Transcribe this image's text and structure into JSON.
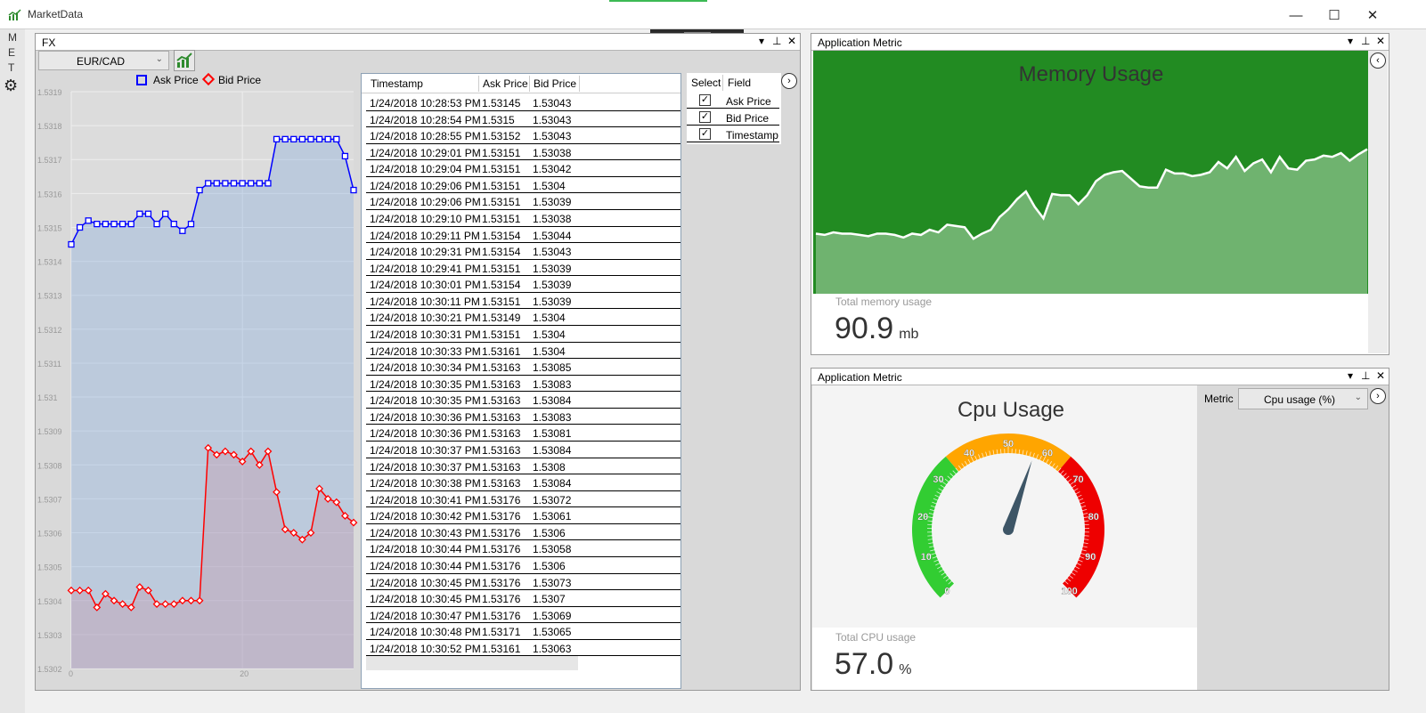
{
  "app": {
    "title": "MarketData",
    "accent": "#3cba54"
  },
  "window_controls": {
    "minimize": "—",
    "maximize": "☐",
    "close": "✕"
  },
  "sidebar": {
    "letters": [
      "M",
      "E",
      "T"
    ],
    "settings_icon": "gear-icon"
  },
  "fx": {
    "title": "FX",
    "panel_controls": [
      "▾",
      "⊥",
      "✕"
    ],
    "currency": "EUR/CAD",
    "legend": [
      {
        "label": "Ask Price",
        "color": "#0000ff"
      },
      {
        "label": "Bid Price",
        "color": "#ff0000"
      }
    ],
    "table": {
      "headers": [
        "Timestamp",
        "Ask Price",
        "Bid Price"
      ],
      "rows": [
        [
          "1/24/2018 10:28:53 PM",
          "1.53145",
          "1.53043"
        ],
        [
          "1/24/2018 10:28:54 PM",
          "1.5315",
          "1.53043"
        ],
        [
          "1/24/2018 10:28:55 PM",
          "1.53152",
          "1.53043"
        ],
        [
          "1/24/2018 10:29:01 PM",
          "1.53151",
          "1.53038"
        ],
        [
          "1/24/2018 10:29:04 PM",
          "1.53151",
          "1.53042"
        ],
        [
          "1/24/2018 10:29:06 PM",
          "1.53151",
          "1.5304"
        ],
        [
          "1/24/2018 10:29:06 PM",
          "1.53151",
          "1.53039"
        ],
        [
          "1/24/2018 10:29:10 PM",
          "1.53151",
          "1.53038"
        ],
        [
          "1/24/2018 10:29:11 PM",
          "1.53154",
          "1.53044"
        ],
        [
          "1/24/2018 10:29:31 PM",
          "1.53154",
          "1.53043"
        ],
        [
          "1/24/2018 10:29:41 PM",
          "1.53151",
          "1.53039"
        ],
        [
          "1/24/2018 10:30:01 PM",
          "1.53154",
          "1.53039"
        ],
        [
          "1/24/2018 10:30:11 PM",
          "1.53151",
          "1.53039"
        ],
        [
          "1/24/2018 10:30:21 PM",
          "1.53149",
          "1.5304"
        ],
        [
          "1/24/2018 10:30:31 PM",
          "1.53151",
          "1.5304"
        ],
        [
          "1/24/2018 10:30:33 PM",
          "1.53161",
          "1.5304"
        ],
        [
          "1/24/2018 10:30:34 PM",
          "1.53163",
          "1.53085"
        ],
        [
          "1/24/2018 10:30:35 PM",
          "1.53163",
          "1.53083"
        ],
        [
          "1/24/2018 10:30:35 PM",
          "1.53163",
          "1.53084"
        ],
        [
          "1/24/2018 10:30:36 PM",
          "1.53163",
          "1.53083"
        ],
        [
          "1/24/2018 10:30:36 PM",
          "1.53163",
          "1.53081"
        ],
        [
          "1/24/2018 10:30:37 PM",
          "1.53163",
          "1.53084"
        ],
        [
          "1/24/2018 10:30:37 PM",
          "1.53163",
          "1.5308"
        ],
        [
          "1/24/2018 10:30:38 PM",
          "1.53163",
          "1.53084"
        ],
        [
          "1/24/2018 10:30:41 PM",
          "1.53176",
          "1.53072"
        ],
        [
          "1/24/2018 10:30:42 PM",
          "1.53176",
          "1.53061"
        ],
        [
          "1/24/2018 10:30:43 PM",
          "1.53176",
          "1.5306"
        ],
        [
          "1/24/2018 10:30:44 PM",
          "1.53176",
          "1.53058"
        ],
        [
          "1/24/2018 10:30:44 PM",
          "1.53176",
          "1.5306"
        ],
        [
          "1/24/2018 10:30:45 PM",
          "1.53176",
          "1.53073"
        ],
        [
          "1/24/2018 10:30:45 PM",
          "1.53176",
          "1.5307"
        ],
        [
          "1/24/2018 10:30:47 PM",
          "1.53176",
          "1.53069"
        ],
        [
          "1/24/2018 10:30:48 PM",
          "1.53171",
          "1.53065"
        ],
        [
          "1/24/2018 10:30:52 PM",
          "1.53161",
          "1.53063"
        ]
      ]
    },
    "field_selector": {
      "headers": [
        "Select",
        "Field"
      ],
      "fields": [
        {
          "label": "Ask Price",
          "checked": true
        },
        {
          "label": "Bid Price",
          "checked": true
        },
        {
          "label": "Timestamp",
          "checked": true
        }
      ]
    }
  },
  "chart_data": {
    "type": "line",
    "title": "",
    "xlabel": "",
    "ylabel": "",
    "ylim": [
      1.5302,
      1.5319
    ],
    "yticks": [
      "1.5319",
      "1.5318",
      "1.5317",
      "1.5316",
      "1.5315",
      "1.5314",
      "1.5313",
      "1.5312",
      "1.5311",
      "1.531",
      "1.5309",
      "1.5308",
      "1.5307",
      "1.5306",
      "1.5305",
      "1.5304",
      "1.5303",
      "1.5302"
    ],
    "xticks": [
      "0",
      "20"
    ],
    "xlim": [
      0,
      33
    ],
    "grid": true,
    "legend_position": "top",
    "series": [
      {
        "name": "Ask Price",
        "color": "#0000ff",
        "values": [
          1.53145,
          1.5315,
          1.53152,
          1.53151,
          1.53151,
          1.53151,
          1.53151,
          1.53151,
          1.53154,
          1.53154,
          1.53151,
          1.53154,
          1.53151,
          1.53149,
          1.53151,
          1.53161,
          1.53163,
          1.53163,
          1.53163,
          1.53163,
          1.53163,
          1.53163,
          1.53163,
          1.53163,
          1.53176,
          1.53176,
          1.53176,
          1.53176,
          1.53176,
          1.53176,
          1.53176,
          1.53176,
          1.53171,
          1.53161
        ]
      },
      {
        "name": "Bid Price",
        "color": "#ff0000",
        "values": [
          1.53043,
          1.53043,
          1.53043,
          1.53038,
          1.53042,
          1.5304,
          1.53039,
          1.53038,
          1.53044,
          1.53043,
          1.53039,
          1.53039,
          1.53039,
          1.5304,
          1.5304,
          1.5304,
          1.53085,
          1.53083,
          1.53084,
          1.53083,
          1.53081,
          1.53084,
          1.5308,
          1.53084,
          1.53072,
          1.53061,
          1.5306,
          1.53058,
          1.5306,
          1.53073,
          1.5307,
          1.53069,
          1.53065,
          1.53063
        ]
      }
    ]
  },
  "memory": {
    "panel_title": "Application Metric",
    "panel_controls": [
      "▾",
      "⊥",
      "✕"
    ],
    "chart_title": "Memory Usage",
    "caption": "Total memory usage",
    "value": "90.9",
    "unit": "mb",
    "color": "#228b22",
    "series": [
      47,
      46,
      48,
      47,
      47,
      46,
      45,
      47,
      47,
      46,
      44,
      47,
      46,
      50,
      48,
      54,
      53,
      52,
      43,
      47,
      50,
      60,
      66,
      74,
      80,
      68,
      59,
      78,
      77,
      77,
      70,
      77,
      88,
      93,
      95,
      96,
      90,
      84,
      83,
      83,
      97,
      94,
      94,
      92,
      93,
      95,
      103,
      98,
      107,
      96,
      102,
      105,
      95,
      107,
      98,
      97,
      104,
      105,
      108,
      107,
      110,
      104,
      109,
      113
    ]
  },
  "cpu": {
    "panel_title": "Application Metric",
    "panel_controls": [
      "▾",
      "⊥",
      "✕"
    ],
    "chart_title": "Cpu Usage",
    "caption": "Total CPU usage",
    "value": "57.0",
    "unit": "%",
    "gauge_value": 57,
    "gauge_ticks": [
      "0",
      "10",
      "20",
      "30",
      "40",
      "50",
      "60",
      "70",
      "80",
      "90",
      "100"
    ],
    "metric_label": "Metric",
    "metric_selected": "Cpu usage (%)",
    "bands": [
      {
        "from": 0,
        "to": 35,
        "color": "#32cd32"
      },
      {
        "from": 35,
        "to": 65,
        "color": "#ffa500"
      },
      {
        "from": 65,
        "to": 100,
        "color": "#ee0000"
      }
    ]
  }
}
